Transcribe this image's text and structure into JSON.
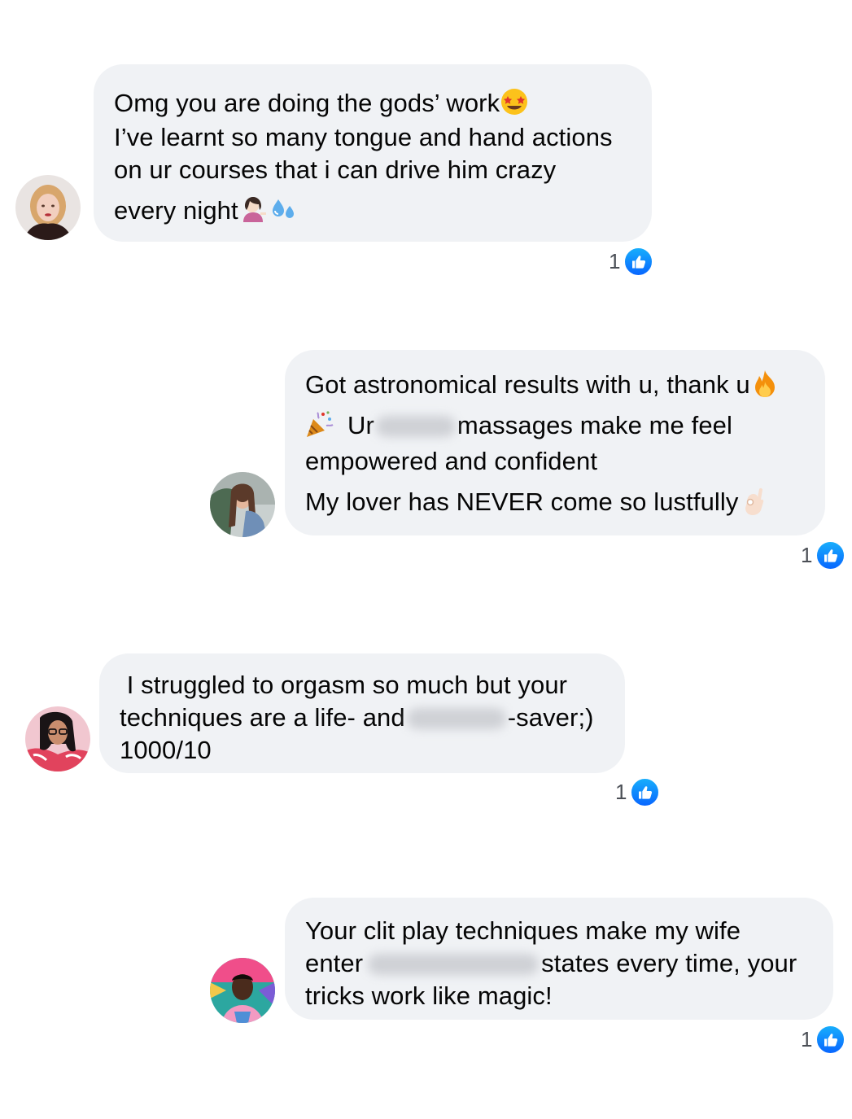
{
  "comments": [
    {
      "avatar_icon": "avatar-woman-blonde",
      "lines": [
        {
          "text": "Omg you are doing the gods’ work",
          "emoji": "star-struck-emoji"
        },
        {
          "text": "I’ve learnt so many tongue and hand actions"
        },
        {
          "text": "on ur courses that i can drive him crazy"
        },
        {
          "text": "every night",
          "emoji": "woman-tipping-hand-emoji",
          "emoji2": "sweat-droplets-emoji"
        }
      ],
      "reaction": {
        "count": "1",
        "icon": "like-icon"
      }
    },
    {
      "avatar_icon": "avatar-woman-denim-jacket",
      "lines": [
        {
          "text": "Got astronomical results with u, thank u",
          "emoji": "fire-emoji"
        },
        {
          "emoji_lead": "party-popper-emoji",
          "text_before": "Ur",
          "redacted": true,
          "text_after": "massages make me feel"
        },
        {
          "text": "empowered and confident"
        },
        {
          "text": "My lover has NEVER come so lustfully",
          "emoji": "ok-hand-emoji"
        }
      ],
      "reaction": {
        "count": "1",
        "icon": "like-icon"
      }
    },
    {
      "avatar_icon": "avatar-woman-glasses",
      "lines": [
        {
          "text": " I struggled to orgasm so much but your"
        },
        {
          "text_before": "techniques are a life- and",
          "redacted": true,
          "text_after": "-saver;)"
        },
        {
          "text": "1000/10"
        }
      ],
      "reaction": {
        "count": "1",
        "icon": "like-icon"
      }
    },
    {
      "avatar_icon": "avatar-man-pink-shirt",
      "lines": [
        {
          "text": "Your clit play techniques make my wife"
        },
        {
          "text_before": "enter",
          "redacted": true,
          "text_after": "states every time, your"
        },
        {
          "text": "tricks work like magic!"
        }
      ],
      "reaction": {
        "count": "1",
        "icon": "like-icon"
      }
    }
  ],
  "colors": {
    "bubble": "#f0f2f5",
    "like_blue": "#0866ff",
    "text": "#050505",
    "count_text": "#4b4f56"
  }
}
